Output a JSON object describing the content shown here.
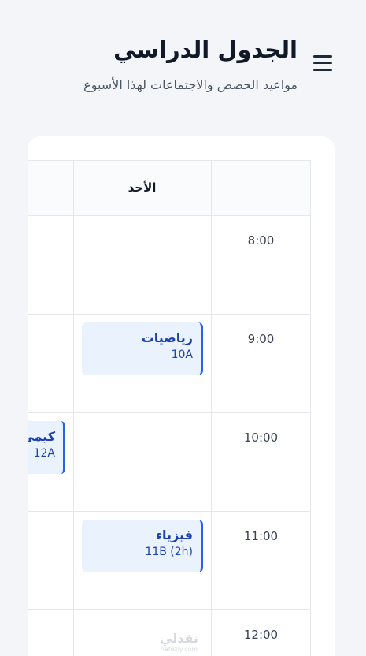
{
  "header": {
    "title": "الجدول الدراسي",
    "subtitle": "مواعيد الحصص والاجتماعات لهذا الأسبوع"
  },
  "table": {
    "day": "الأحد",
    "times": [
      "8:00",
      "9:00",
      "10:00",
      "11:00",
      "12:00"
    ],
    "events": [
      {
        "subject": "رياضيات",
        "class": "10A"
      },
      {
        "subject": "كيمي",
        "class": "12A"
      },
      {
        "subject": "فيزياء",
        "class": "11B (2h)"
      }
    ]
  },
  "watermark": {
    "text": "نفذلي",
    "sub": "nafezly.com"
  },
  "colors": {
    "accent": "#2563eb",
    "event_bg": "#eaf3fd",
    "background": "#f3f5f8"
  }
}
